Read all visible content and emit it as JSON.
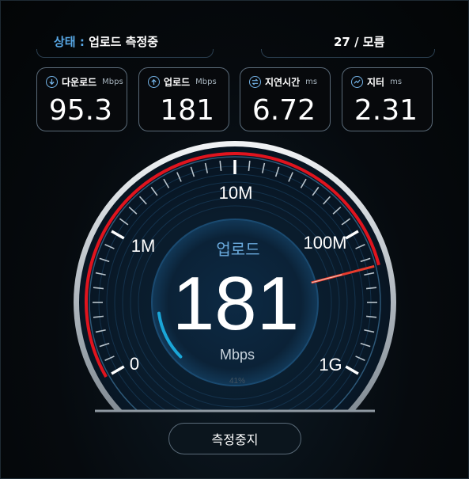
{
  "header": {
    "status_label": "상태",
    "status_sep": " : ",
    "status_value": "업로드 측정중",
    "server_label": "27 / 모름"
  },
  "stats": [
    {
      "icon": "download-icon",
      "label": "다운로드",
      "unit": "Mbps",
      "value": "95.3"
    },
    {
      "icon": "upload-icon",
      "label": "업로드",
      "unit": "Mbps",
      "value": "181"
    },
    {
      "icon": "latency-icon",
      "label": "지연시간",
      "unit": "ms",
      "value": "6.72"
    },
    {
      "icon": "jitter-icon",
      "label": "지터",
      "unit": "ms",
      "value": "2.31"
    }
  ],
  "gauge": {
    "mode_label": "업로드",
    "value": "181",
    "unit": "Mbps",
    "progress_label": "41%",
    "progress": 0.41,
    "needle_mbps": 181,
    "scale_labels": [
      "0",
      "1M",
      "10M",
      "100M",
      "1G"
    ],
    "accent_color": "#e0141e",
    "progress_color": "#1aa6d8"
  },
  "button": {
    "label": "측정중지"
  }
}
